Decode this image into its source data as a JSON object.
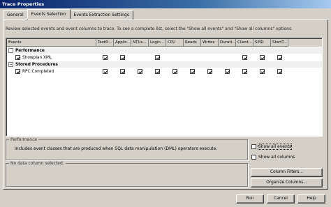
{
  "window": {
    "title": "Trace Properties"
  },
  "tabs": [
    {
      "label": "General"
    },
    {
      "label": "Events Selection"
    },
    {
      "label": "Events Extraction Settings"
    }
  ],
  "description": "Review selected events and event columns to trace. To see a complete list, select the \"Show all events\" and \"Show all columns\" options.",
  "grid": {
    "columns": [
      "Events",
      "TextD...",
      "Applic...",
      "NTUs...",
      "Login...",
      "CPU",
      "Reads",
      "Writes",
      "Durati...",
      "Client...",
      "SPID",
      "StartT..."
    ],
    "rows": [
      {
        "type": "category",
        "label": "Performance",
        "expander": "",
        "checks": [
          false,
          false,
          false,
          false,
          false,
          false,
          false,
          false,
          false,
          false,
          false
        ]
      },
      {
        "type": "event",
        "label": "Showplan XML",
        "checked": true,
        "checks": [
          true,
          true,
          false,
          true,
          false,
          false,
          false,
          false,
          true,
          true,
          true
        ]
      },
      {
        "type": "category",
        "label": "Stored Procedures",
        "expander": "−",
        "checks": [
          false,
          false,
          false,
          false,
          false,
          false,
          false,
          false,
          false,
          false,
          false
        ]
      },
      {
        "type": "event",
        "label": "RPC:Completed",
        "checked": true,
        "checks": [
          true,
          true,
          true,
          true,
          true,
          true,
          true,
          true,
          true,
          true,
          true
        ]
      }
    ]
  },
  "info": {
    "legend": "Performance",
    "text": "Includes event classes that are produced when SQL data manipulation (DML) operators execute."
  },
  "column_info": {
    "legend": "No data column selected."
  },
  "options": {
    "show_all_events": "Show all events",
    "show_all_columns": "Show all columns"
  },
  "buttons": {
    "column_filters": "Column Filters...",
    "organize_columns": "Organize Columns...",
    "run": "Run",
    "cancel": "Cancel",
    "help": "Help"
  }
}
